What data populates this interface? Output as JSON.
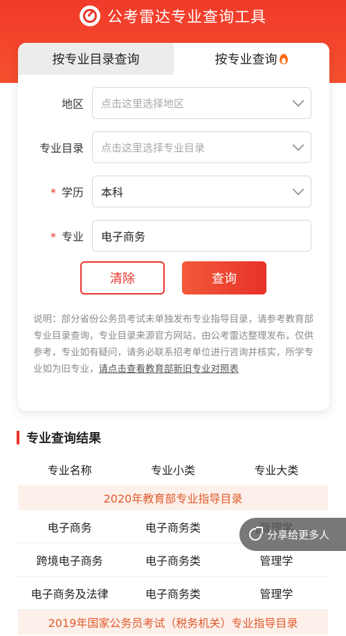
{
  "header": {
    "title": "公考雷达专业查询工具",
    "logo_icon": "radar-logo-icon"
  },
  "tabs": [
    {
      "label": "按专业目录查询",
      "active": false
    },
    {
      "label": "按专业查询",
      "active": true,
      "badge_icon": "fire-icon"
    }
  ],
  "form": {
    "region": {
      "label": "地区",
      "placeholder": "点击这里选择地区",
      "value": ""
    },
    "catalog": {
      "label": "专业目录",
      "placeholder": "点击这里选择专业目录",
      "value": ""
    },
    "education": {
      "label": "学历",
      "required_mark": "*",
      "value": "本科"
    },
    "major": {
      "label": "专业",
      "required_mark": "*",
      "value": "电子商务"
    }
  },
  "buttons": {
    "clear": "清除",
    "query": "查询"
  },
  "note": {
    "text": "说明：部分省份公务员考试未单独发布专业指导目录，请参考教育部专业目录查询，专业目录来源官方网站，由公考雷达整理发布，仅供参考，专业如有疑问，请务必联系招考单位进行咨询并核实，所学专业如为旧专业，",
    "link": "请点击查看教育部新旧专业对照表"
  },
  "results": {
    "title": "专业查询结果",
    "columns": [
      "专业名称",
      "专业小类",
      "专业大类"
    ],
    "groups": [
      {
        "name": "2020年教育部专业指导目录",
        "rows": [
          [
            "电子商务",
            "电子商务类",
            "管理学"
          ],
          [
            "跨境电子商务",
            "电子商务类",
            "管理学"
          ],
          [
            "电子商务及法律",
            "电子商务类",
            "管理学"
          ]
        ]
      },
      {
        "name": "2019年国家公务员考试（税务机关）专业指导目录",
        "rows": []
      }
    ]
  },
  "share": {
    "label": "分享给更多人"
  },
  "colors": {
    "brand": "#e8322a",
    "group_header_bg": "#fdf0ea"
  }
}
